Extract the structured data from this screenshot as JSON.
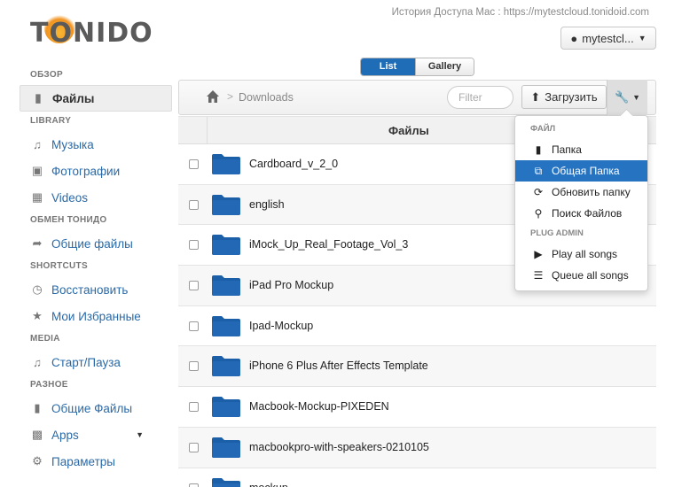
{
  "header": {
    "logo": "TONIDO",
    "access_text": "История Доступа Mac : https://mytestcloud.tonidoid.com",
    "user_label": "mytestcl..."
  },
  "sidebar": {
    "sections": [
      {
        "title": "ОБЗОР",
        "items": [
          {
            "label": "Файлы",
            "icon": "folder-icon",
            "active": true
          }
        ]
      },
      {
        "title": "LIBRARY",
        "items": [
          {
            "label": "Музыка",
            "icon": "music-icon"
          },
          {
            "label": "Фотографии",
            "icon": "photo-icon"
          },
          {
            "label": "Videos",
            "icon": "film-icon"
          }
        ]
      },
      {
        "title": "ОБМЕН ТОНИДО",
        "items": [
          {
            "label": "Общие файлы",
            "icon": "share-icon"
          }
        ]
      },
      {
        "title": "SHORTCUTS",
        "items": [
          {
            "label": "Восстановить",
            "icon": "clock-icon"
          },
          {
            "label": "Мои Избранные",
            "icon": "star-icon"
          }
        ]
      },
      {
        "title": "MEDIA",
        "items": [
          {
            "label": "Старт/Пауза",
            "icon": "music-icon"
          }
        ]
      },
      {
        "title": "РАЗНОЕ",
        "items": [
          {
            "label": "Общие Файлы",
            "icon": "video-camera-icon"
          },
          {
            "label": "Apps",
            "icon": "chart-icon",
            "dropdown": true
          },
          {
            "label": "Параметры",
            "icon": "cogs-icon"
          }
        ]
      }
    ]
  },
  "view_toggle": {
    "list": "List",
    "gallery": "Gallery",
    "selected": "List"
  },
  "toolbar": {
    "breadcrumb": "Downloads",
    "filter_placeholder": "Filter",
    "upload_label": "Загрузить"
  },
  "table": {
    "header": "Файлы",
    "rows": [
      "Cardboard_v_2_0",
      "english",
      "iMock_Up_Real_Footage_Vol_3",
      "iPad Pro Mockup",
      "Ipad-Mockup",
      "iPhone 6 Plus After Effects Template",
      "Macbook-Mockup-PIXEDEN",
      "macbookpro-with-speakers-0210105",
      "mockup"
    ]
  },
  "menu": {
    "groups": [
      {
        "title": "ФАЙЛ",
        "items": [
          {
            "label": "Папка",
            "icon": "folder-icon"
          },
          {
            "label": "Общая Папка",
            "icon": "external-link-icon",
            "highlighted": true
          },
          {
            "label": "Обновить папку",
            "icon": "refresh-icon"
          },
          {
            "label": "Поиск Файлов",
            "icon": "search-icon"
          }
        ]
      },
      {
        "title": "PLUG ADMIN",
        "items": [
          {
            "label": "Play all songs",
            "icon": "play-icon"
          },
          {
            "label": "Queue all songs",
            "icon": "list-icon"
          }
        ]
      }
    ]
  },
  "colors": {
    "accent": "#1f6db6",
    "link": "#2a6aa8",
    "folder": "#1b5fa8",
    "logo_sun": "#f29422"
  }
}
